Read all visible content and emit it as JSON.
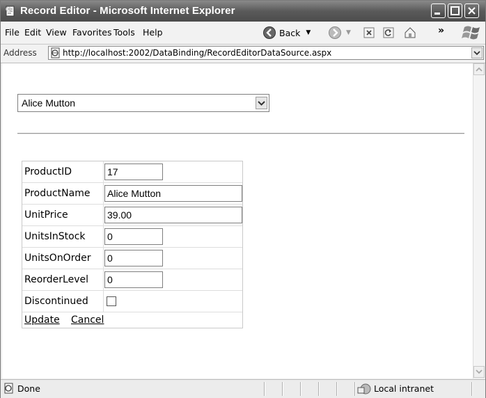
{
  "window": {
    "title": "Record Editor - Microsoft Internet Explorer"
  },
  "menu": [
    "File",
    "Edit",
    "View",
    "Favorites",
    "Tools",
    "Help"
  ],
  "toolbar": {
    "back_label": "Back",
    "overflow": "»"
  },
  "address": {
    "label": "Address",
    "url": "http://localhost:2002/DataBinding/RecordEditorDataSource.aspx"
  },
  "page": {
    "dropdown": {
      "selected": "Alice Mutton"
    },
    "fields": [
      {
        "label": "ProductID",
        "value": "17"
      },
      {
        "label": "ProductName",
        "value": "Alice Mutton"
      },
      {
        "label": "UnitPrice",
        "value": "39.00"
      },
      {
        "label": "UnitsInStock",
        "value": "0"
      },
      {
        "label": "UnitsOnOrder",
        "value": "0"
      },
      {
        "label": "ReorderLevel",
        "value": "0"
      },
      {
        "label": "Discontinued",
        "checked": false
      }
    ],
    "links": {
      "update": "Update",
      "cancel": "Cancel"
    }
  },
  "status": {
    "text": "Done",
    "zone": "Local intranet"
  }
}
